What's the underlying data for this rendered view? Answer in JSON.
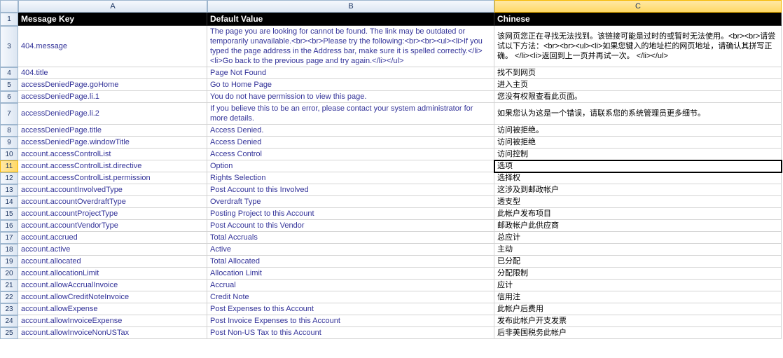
{
  "columns": [
    "A",
    "B",
    "C"
  ],
  "headers": {
    "A": "Message Key",
    "B": "Default Value",
    "C": "Chinese"
  },
  "activeCell": {
    "row": 11,
    "col": "C"
  },
  "selectedColumn": "C",
  "rows": [
    {
      "n": 3,
      "A": "404.message",
      "B": "The page you are looking for cannot be found. The link may be outdated or temporarily unavailable.<br><br>Please try the following:<br><br><ul><li>If you typed the page address in the Address bar, make sure it is spelled correctly.</li><li>Go back to the previous page and try again.</li></ul>",
      "C": "该网页您正在寻找无法找到。该链接可能是过时的或暂时无法使用。<br><br>请尝试以下方法：<br><br><ul><li>如果您键入的地址栏的网页地址，请确认其拼写正确。 </li><li>返回到上一页并再试一次。 </li></ul>"
    },
    {
      "n": 4,
      "A": "404.title",
      "B": "Page Not Found",
      "C": "找不到网页"
    },
    {
      "n": 5,
      "A": "accessDeniedPage.goHome",
      "B": "Go to Home Page",
      "C": "进入主页"
    },
    {
      "n": 6,
      "A": "accessDeniedPage.li.1",
      "B": "You do not have permission to view this page.",
      "C": "您没有权限查看此页面。"
    },
    {
      "n": 7,
      "A": "accessDeniedPage.li.2",
      "B": "If you believe this to be an error, please contact your system administrator for more details.",
      "C": "如果您认为这是一个错误，请联系您的系统管理员更多细节。"
    },
    {
      "n": 8,
      "A": "accessDeniedPage.title",
      "B": "Access Denied.",
      "C": "访问被拒绝。"
    },
    {
      "n": 9,
      "A": "accessDeniedPage.windowTitle",
      "B": "Access Denied",
      "C": "访问被拒绝"
    },
    {
      "n": 10,
      "A": "account.accessControlList",
      "B": "Access Control",
      "C": "访问控制"
    },
    {
      "n": 11,
      "A": "account.accessControlList.directive",
      "B": "Option",
      "C": "选项"
    },
    {
      "n": 12,
      "A": "account.accessControlList.permission",
      "B": "Rights Selection",
      "C": "选择权"
    },
    {
      "n": 13,
      "A": "account.accountInvolvedType",
      "B": "Post Account to this Involved",
      "C": "这涉及到邮政帐户"
    },
    {
      "n": 14,
      "A": "account.accountOverdraftType",
      "B": "Overdraft Type",
      "C": "透支型"
    },
    {
      "n": 15,
      "A": "account.accountProjectType",
      "B": "Posting Project to this Account",
      "C": "此帐户发布项目"
    },
    {
      "n": 16,
      "A": "account.accountVendorType",
      "B": "Post Account to this Vendor",
      "C": "邮政帐户此供应商"
    },
    {
      "n": 17,
      "A": "account.accrued",
      "B": "Total Accruals",
      "C": "总应计"
    },
    {
      "n": 18,
      "A": "account.active",
      "B": "Active",
      "C": "主动"
    },
    {
      "n": 19,
      "A": "account.allocated",
      "B": "Total Allocated",
      "C": "已分配"
    },
    {
      "n": 20,
      "A": "account.allocationLimit",
      "B": "Allocation Limit",
      "C": "分配限制"
    },
    {
      "n": 21,
      "A": "account.allowAccrualInvoice",
      "B": "Accrual",
      "C": "应计"
    },
    {
      "n": 22,
      "A": "account.allowCreditNoteInvoice",
      "B": "Credit Note",
      "C": "信用注"
    },
    {
      "n": 23,
      "A": "account.allowExpense",
      "B": "Post Expenses to this Account",
      "C": "此帐户后费用"
    },
    {
      "n": 24,
      "A": "account.allowInvoiceExpense",
      "B": "Post Invoice Expenses to this Account",
      "C": "发布此帐户开支发票"
    },
    {
      "n": 25,
      "A": "account.allowInvoiceNonUSTax",
      "B": "Post Non-US Tax to this Account",
      "C": "后非美国税务此帐户"
    }
  ]
}
